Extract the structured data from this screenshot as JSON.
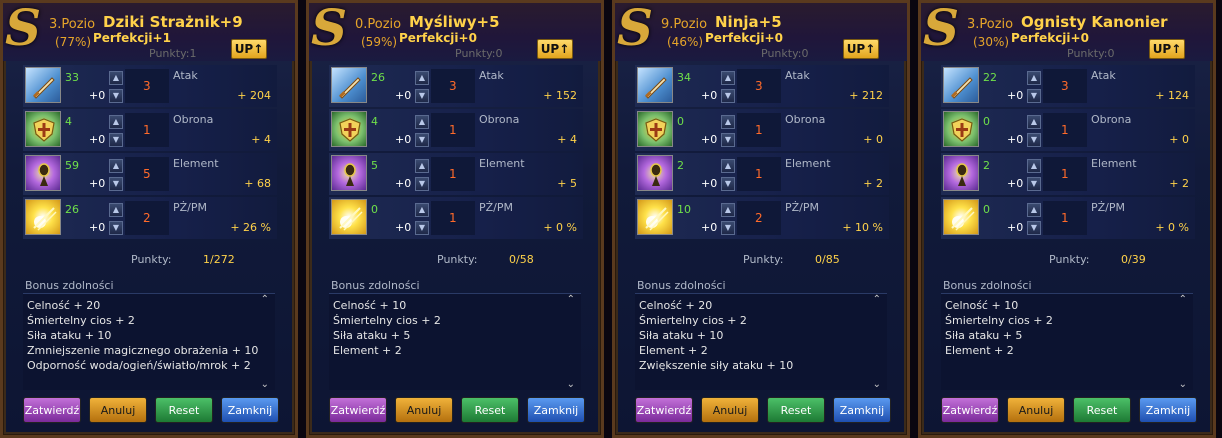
{
  "panels": [
    {
      "level": "3.Pozio",
      "percent": "(77%)",
      "title": "Dziki Strażnik+9",
      "perfection": "Perfekcji+1",
      "points_header": "Punkty:1",
      "up_label": "UP",
      "stats": [
        {
          "name": "Atak",
          "base": "33",
          "plus": "+0",
          "add": "3",
          "bonus": "+ 204",
          "icon": "sword-icon"
        },
        {
          "name": "Obrona",
          "base": "4",
          "plus": "+0",
          "add": "1",
          "bonus": "+ 4",
          "icon": "shield-icon"
        },
        {
          "name": "Element",
          "base": "59",
          "plus": "+0",
          "add": "5",
          "bonus": "+ 68",
          "icon": "element-icon"
        },
        {
          "name": "PŻ/PM",
          "base": "26",
          "plus": "+0",
          "add": "2",
          "bonus": "+ 26 %",
          "icon": "hp-mp-icon"
        }
      ],
      "punkty_label": "Punkty:",
      "punkty_value": "1/272",
      "bonus_title": "Bonus zdolności",
      "bonus_items": [
        "Celność + 20",
        "Śmiertelny cios + 2",
        "Siła ataku + 10",
        "Zmniejszenie magicznego obrażenia + 10",
        "Odporność woda/ogień/światło/mrok + 2"
      ],
      "buttons": [
        "Zatwierdź",
        "Anuluj",
        "Reset",
        "Zamknij"
      ]
    },
    {
      "level": "0.Pozio",
      "percent": "(59%)",
      "title": "Myśliwy+5",
      "perfection": "Perfekcji+0",
      "points_header": "Punkty:0",
      "up_label": "UP",
      "stats": [
        {
          "name": "Atak",
          "base": "26",
          "plus": "+0",
          "add": "3",
          "bonus": "+ 152",
          "icon": "sword-icon"
        },
        {
          "name": "Obrona",
          "base": "4",
          "plus": "+0",
          "add": "1",
          "bonus": "+ 4",
          "icon": "shield-icon"
        },
        {
          "name": "Element",
          "base": "5",
          "plus": "+0",
          "add": "1",
          "bonus": "+ 5",
          "icon": "element-icon"
        },
        {
          "name": "PŻ/PM",
          "base": "0",
          "plus": "+0",
          "add": "1",
          "bonus": "+ 0 %",
          "icon": "hp-mp-icon"
        }
      ],
      "punkty_label": "Punkty:",
      "punkty_value": "0/58",
      "bonus_title": "Bonus zdolności",
      "bonus_items": [
        "Celność + 10",
        "Śmiertelny cios + 2",
        "Siła ataku + 5",
        "Element + 2"
      ],
      "buttons": [
        "Zatwierdź",
        "Anuluj",
        "Reset",
        "Zamknij"
      ]
    },
    {
      "level": "9.Pozio",
      "percent": "(46%)",
      "title": "Ninja+5",
      "perfection": "Perfekcji+0",
      "points_header": "Punkty:0",
      "up_label": "UP",
      "stats": [
        {
          "name": "Atak",
          "base": "34",
          "plus": "+0",
          "add": "3",
          "bonus": "+ 212",
          "icon": "sword-icon"
        },
        {
          "name": "Obrona",
          "base": "0",
          "plus": "+0",
          "add": "1",
          "bonus": "+ 0",
          "icon": "shield-icon"
        },
        {
          "name": "Element",
          "base": "2",
          "plus": "+0",
          "add": "1",
          "bonus": "+ 2",
          "icon": "element-icon"
        },
        {
          "name": "PŻ/PM",
          "base": "10",
          "plus": "+0",
          "add": "2",
          "bonus": "+ 10 %",
          "icon": "hp-mp-icon"
        }
      ],
      "punkty_label": "Punkty:",
      "punkty_value": "0/85",
      "bonus_title": "Bonus zdolności",
      "bonus_items": [
        "Celność + 20",
        "Śmiertelny cios + 2",
        "Siła ataku + 10",
        "Element + 2",
        "Zwiększenie siły ataku + 10"
      ],
      "buttons": [
        "Zatwierdź",
        "Anuluj",
        "Reset",
        "Zamknij"
      ]
    },
    {
      "level": "3.Pozio",
      "percent": "(30%)",
      "title": "Ognisty Kanonier",
      "perfection": "Perfekcji+0",
      "points_header": "Punkty:0",
      "up_label": "UP",
      "stats": [
        {
          "name": "Atak",
          "base": "22",
          "plus": "+0",
          "add": "3",
          "bonus": "+ 124",
          "icon": "sword-icon"
        },
        {
          "name": "Obrona",
          "base": "0",
          "plus": "+0",
          "add": "1",
          "bonus": "+ 0",
          "icon": "shield-icon"
        },
        {
          "name": "Element",
          "base": "2",
          "plus": "+0",
          "add": "1",
          "bonus": "+ 2",
          "icon": "element-icon"
        },
        {
          "name": "PŻ/PM",
          "base": "0",
          "plus": "+0",
          "add": "1",
          "bonus": "+ 0 %",
          "icon": "hp-mp-icon"
        }
      ],
      "punkty_label": "Punkty:",
      "punkty_value": "0/39",
      "bonus_title": "Bonus zdolności",
      "bonus_items": [
        "Celność + 10",
        "Śmiertelny cios + 2",
        "Siła ataku + 5",
        "Element + 2"
      ],
      "buttons": [
        "Zatwierdź",
        "Anuluj",
        "Reset",
        "Zamknij"
      ]
    }
  ]
}
